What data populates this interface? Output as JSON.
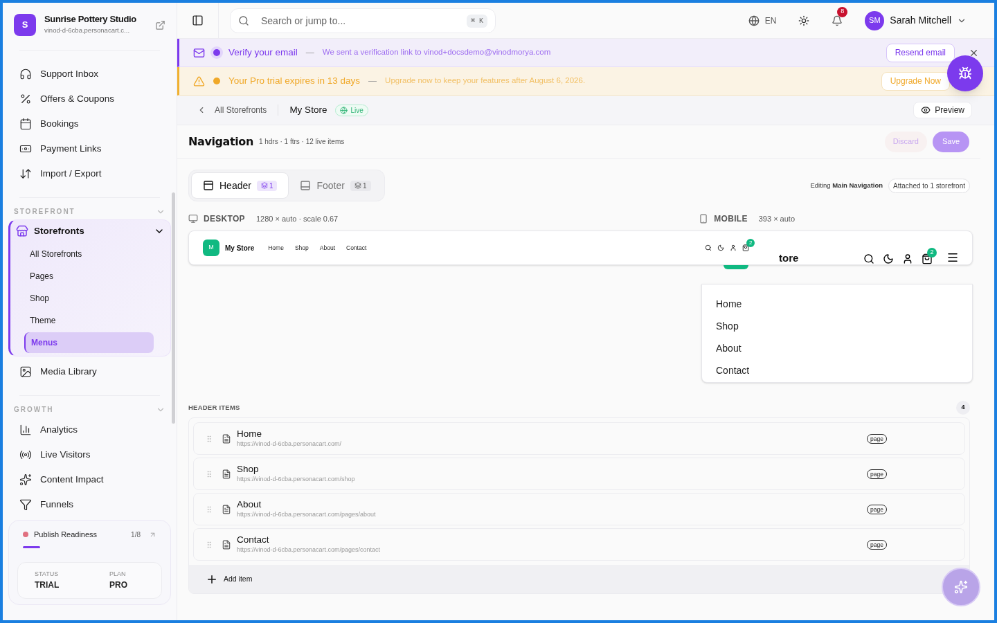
{
  "brand": {
    "initial": "S",
    "name": "Sunrise Pottery Studio",
    "url": "vinod-d-6cba.personacart.c..."
  },
  "nav_top": [
    {
      "kind": "headset",
      "label": "Support Inbox"
    },
    {
      "kind": "percent",
      "label": "Offers & Coupons"
    },
    {
      "kind": "calendar",
      "label": "Bookings"
    },
    {
      "kind": "money",
      "label": "Payment Links"
    },
    {
      "kind": "arrows",
      "label": "Import / Export"
    }
  ],
  "storefront_section": {
    "title": "STOREFRONT",
    "group": {
      "label": "Storefronts",
      "expanded": true,
      "children": [
        {
          "label": "All Storefronts",
          "selected": false
        },
        {
          "label": "Pages",
          "selected": false
        },
        {
          "label": "Shop",
          "selected": false
        },
        {
          "label": "Theme",
          "selected": false
        },
        {
          "label": "Menus",
          "selected": true
        }
      ]
    },
    "after": {
      "kind": "image",
      "label": "Media Library"
    }
  },
  "growth_section": {
    "title": "GROWTH",
    "items": [
      {
        "kind": "chart",
        "label": "Analytics"
      },
      {
        "kind": "radio",
        "label": "Live Visitors"
      },
      {
        "kind": "sparkles",
        "label": "Content Impact"
      },
      {
        "kind": "filter",
        "label": "Funnels"
      }
    ]
  },
  "readiness": {
    "label": "Publish Readiness",
    "count": "1/8",
    "level": 0.125,
    "color": "#e07080",
    "status_label": "STATUS",
    "status": "TRIAL",
    "plan_label": "PLAN",
    "plan": "PRO"
  },
  "topbar": {
    "search_placeholder": "Search or jump to...",
    "shortcut": "⌘ K",
    "language": "EN",
    "notifications": "8",
    "user_initials": "SM",
    "user_name": "Sarah Mitchell"
  },
  "banners": [
    {
      "kind": "email",
      "title": "Verify your email",
      "separator": "—",
      "text": "We sent a verification link to vinod+docsdemo@vinodmorya.com",
      "button": "Resend email",
      "closable": true
    },
    {
      "kind": "warning",
      "title": "Your Pro trial expires in 13 days",
      "separator": "—",
      "text": "Upgrade now to keep your features after August 6, 2026.",
      "button": "Upgrade Now",
      "closable": false
    }
  ],
  "breadcrumb": {
    "back": "All Storefronts",
    "store": "My Store",
    "status": "Live"
  },
  "preview_button": "Preview",
  "page": {
    "title": "Navigation",
    "summary": "1 hdrs · 1 ftrs · 12 live items",
    "discard": "Discard",
    "save": "Save"
  },
  "tabs": [
    {
      "kind": "header",
      "label": "Header",
      "count": "1",
      "selected": true
    },
    {
      "kind": "footer",
      "label": "Footer",
      "count": "1",
      "selected": false
    }
  ],
  "editing": {
    "prefix": "Editing",
    "menu": "Main Navigation",
    "attached": "Attached to 1 storefront"
  },
  "desktop_preview": {
    "label": "DESKTOP",
    "size": "1280 × auto · scale 0.67",
    "logo": "M",
    "store": "My Store",
    "links": [
      "Home",
      "Shop",
      "About",
      "Contact"
    ],
    "cart_count": "2"
  },
  "mobile_preview": {
    "label": "MOBILE",
    "size": "393 × auto",
    "store": "tore",
    "cart_count": "2",
    "links": [
      "Home",
      "Shop",
      "About",
      "Contact"
    ]
  },
  "header_items": {
    "title": "HEADER ITEMS",
    "count": "4",
    "items": [
      {
        "label": "Home",
        "url": "https://vinod-d-6cba.personacart.com/",
        "type": "page"
      },
      {
        "label": "Shop",
        "url": "https://vinod-d-6cba.personacart.com/shop",
        "type": "page"
      },
      {
        "label": "About",
        "url": "https://vinod-d-6cba.personacart.com/pages/about",
        "type": "page"
      },
      {
        "label": "Contact",
        "url": "https://vinod-d-6cba.personacart.com/pages/contact",
        "type": "page"
      }
    ],
    "add": "Add item"
  }
}
